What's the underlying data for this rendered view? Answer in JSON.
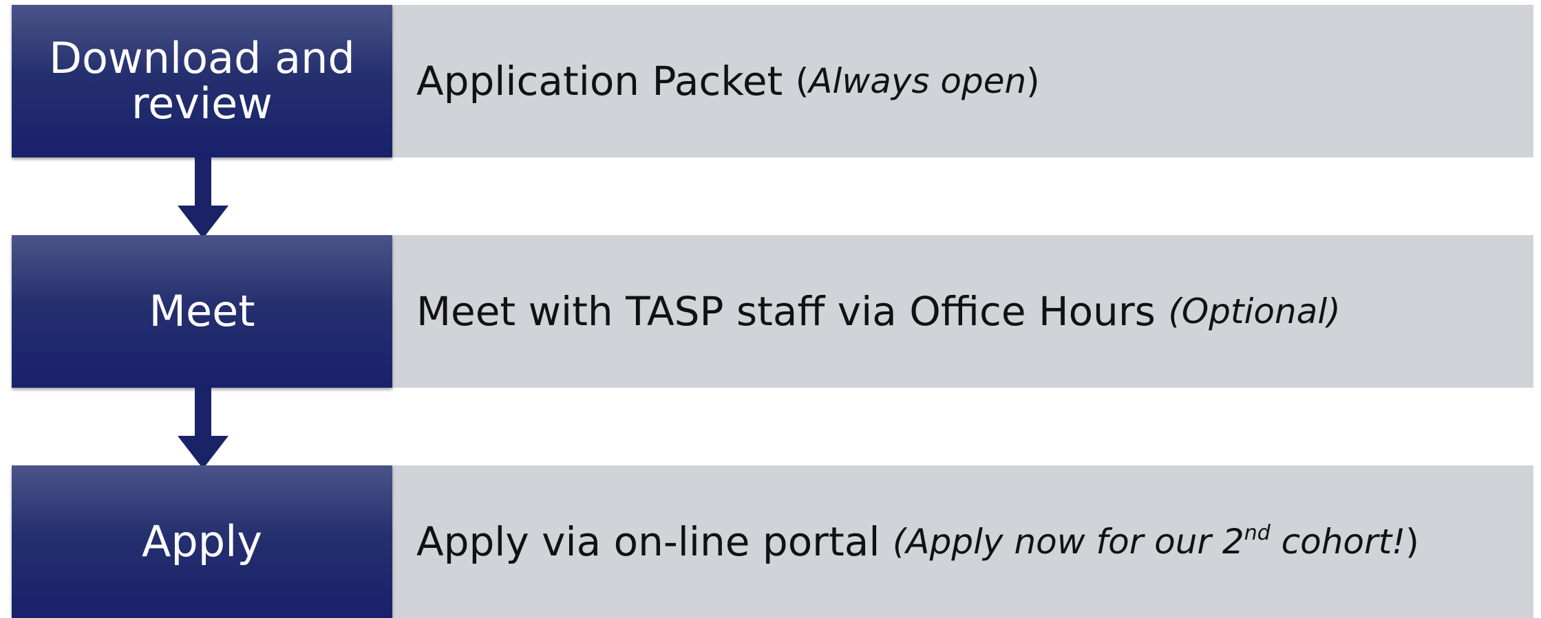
{
  "steps": [
    {
      "label": "Download and review",
      "description": "Application Packet",
      "note_open": "(",
      "note": "Always open",
      "note_close": ")"
    },
    {
      "label": "Meet",
      "description": "Meet with TASP staff via Office Hours",
      "note": "(Optional)"
    },
    {
      "label": "Apply",
      "description": "Apply via on-line portal",
      "note_a": "(Apply now for our 2",
      "note_sup": "nd",
      "note_b": " cohort!",
      "note_close": ")"
    }
  ],
  "colors": {
    "box_dark": "#18216a",
    "box_light": "#4b5488",
    "bar": "#d2d3d8",
    "arrow": "#1a2268"
  }
}
